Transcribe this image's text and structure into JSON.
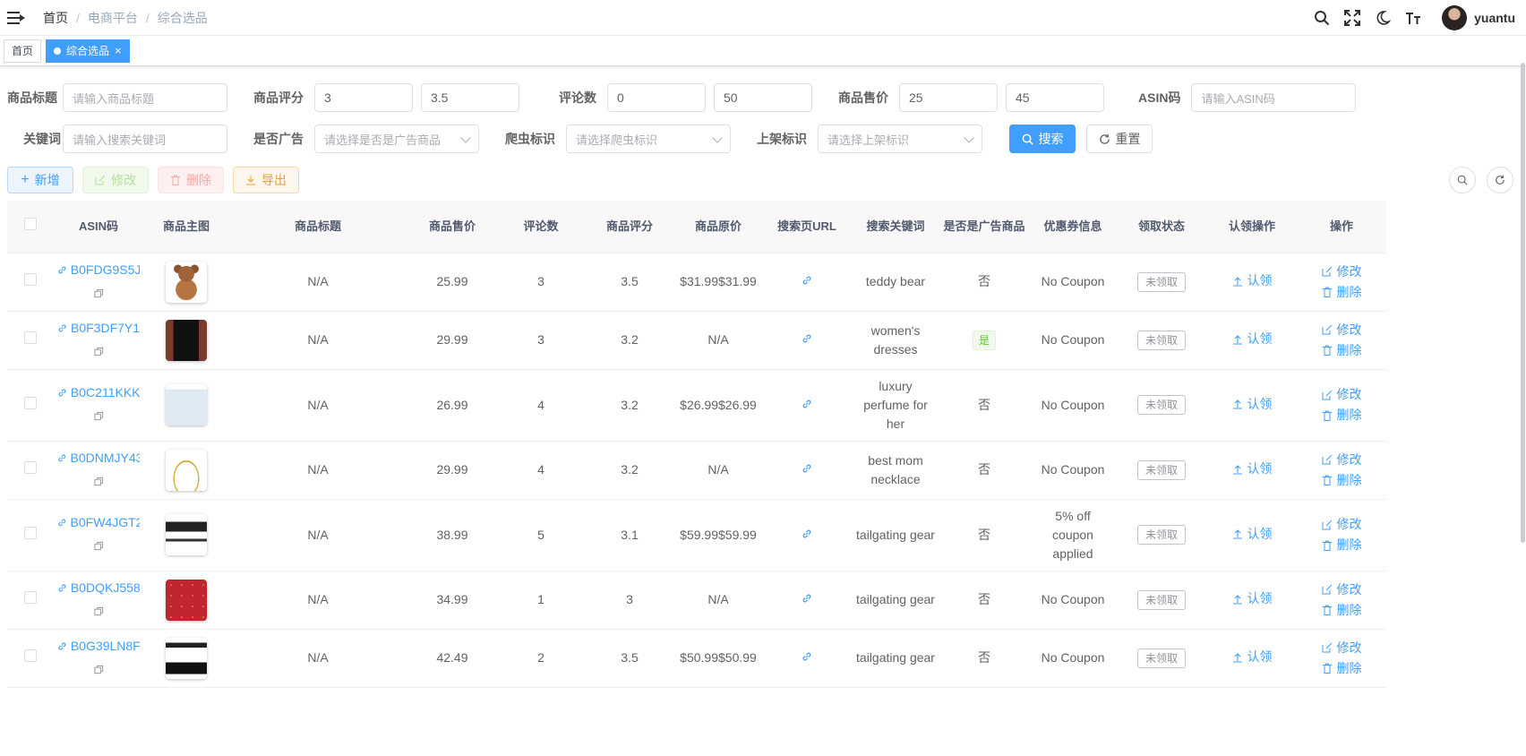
{
  "navbar": {
    "breadcrumb": [
      "首页",
      "电商平台",
      "综合选品"
    ],
    "separator": "/",
    "username": "yuantu"
  },
  "tags": [
    {
      "label": "首页",
      "active": false
    },
    {
      "label": "综合选品",
      "active": true
    }
  ],
  "search": {
    "title_label": "商品标题",
    "title_placeholder": "请输入商品标题",
    "rating_label": "商品评分",
    "rating_min": "3",
    "rating_max": "3.5",
    "reviews_label": "评论数",
    "reviews_min": "0",
    "reviews_max": "50",
    "price_label": "商品售价",
    "price_min": "25",
    "price_max": "45",
    "asin_label": "ASIN码",
    "asin_placeholder": "请输入ASIN码",
    "keyword_label": "关键词",
    "keyword_placeholder": "请输入搜索关键词",
    "ad_label": "是否广告",
    "ad_placeholder": "请选择是否是广告商品",
    "crawler_label": "爬虫标识",
    "crawler_placeholder": "请选择爬虫标识",
    "listing_label": "上架标识",
    "listing_placeholder": "请选择上架标识",
    "search_button": "搜索",
    "reset_button": "重置"
  },
  "toolbar": {
    "add": "新增",
    "edit": "修改",
    "delete": "删除",
    "export": "导出"
  },
  "table": {
    "headers": [
      "ASIN码",
      "商品主图",
      "商品标题",
      "商品售价",
      "评论数",
      "商品评分",
      "商品原价",
      "搜索页URL",
      "搜索关键词",
      "是否是广告商品",
      "优惠券信息",
      "领取状态",
      "认领操作",
      "操作"
    ],
    "claim_label": "认领",
    "edit_label": "修改",
    "delete_label": "删除",
    "rows": [
      {
        "asin": "B0FDG9S5J",
        "image": "teddy-bear",
        "title": "N/A",
        "price": "25.99",
        "reviews": "3",
        "rating": "3.5",
        "original_price": "$31.99$31.99",
        "keyword": "teddy bear",
        "is_ad": "否",
        "coupon": "No Coupon",
        "claim_status": "未领取"
      },
      {
        "asin": "B0F3DF7Y1",
        "image": "black-dress",
        "title": "N/A",
        "price": "29.99",
        "reviews": "3",
        "rating": "3.2",
        "original_price": "N/A",
        "keyword": "women's dresses",
        "is_ad": "是",
        "coupon": "No Coupon",
        "claim_status": "未领取"
      },
      {
        "asin": "B0C211KKK",
        "image": "perfume-box",
        "title": "N/A",
        "price": "26.99",
        "reviews": "4",
        "rating": "3.2",
        "original_price": "$26.99$26.99",
        "keyword": "luxury perfume for her",
        "is_ad": "否",
        "coupon": "No Coupon",
        "claim_status": "未领取"
      },
      {
        "asin": "B0DNMJY43",
        "image": "necklace",
        "title": "N/A",
        "price": "29.99",
        "reviews": "4",
        "rating": "3.2",
        "original_price": "N/A",
        "keyword": "best mom necklace",
        "is_ad": "否",
        "coupon": "No Coupon",
        "claim_status": "未领取"
      },
      {
        "asin": "B0FW4JGT2",
        "image": "grill-table",
        "title": "N/A",
        "price": "38.99",
        "reviews": "5",
        "rating": "3.1",
        "original_price": "$59.99$59.99",
        "keyword": "tailgating gear",
        "is_ad": "否",
        "coupon": "5% off coupon applied",
        "claim_status": "未领取"
      },
      {
        "asin": "B0DQKJ558",
        "image": "red-blanket",
        "title": "N/A",
        "price": "34.99",
        "reviews": "1",
        "rating": "3",
        "original_price": "N/A",
        "keyword": "tailgating gear",
        "is_ad": "否",
        "coupon": "No Coupon",
        "claim_status": "未领取"
      },
      {
        "asin": "B0G39LN8F",
        "image": "folding-table",
        "title": "N/A",
        "price": "42.49",
        "reviews": "2",
        "rating": "3.5",
        "original_price": "$50.99$50.99",
        "keyword": "tailgating gear",
        "is_ad": "否",
        "coupon": "No Coupon",
        "claim_status": "未领取"
      }
    ]
  },
  "colors": {
    "primary": "#409eff",
    "success": "#67c23a",
    "warning": "#e6a23c",
    "danger": "#f56c6c"
  }
}
